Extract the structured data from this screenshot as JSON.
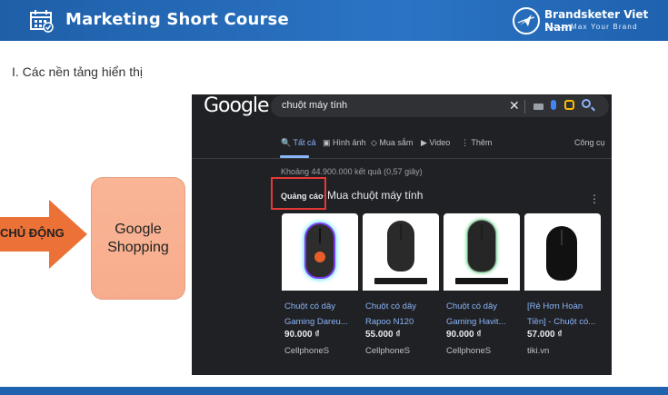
{
  "header": {
    "title": "Marketing Short Course",
    "brand_name": "Brandsketer Viet Nam",
    "brand_tagline": "Max Your Brand",
    "color": "#1f62ae"
  },
  "section_heading": "I.  Các nền tảng hiển thị",
  "diagram": {
    "arrow_label": "CHỦ ĐỘNG",
    "arrow_color": "#ec7136",
    "box_line1": "Google",
    "box_line2": "Shopping",
    "box_color": "#f7ad8d"
  },
  "google": {
    "logo": "Google",
    "search_query": "chuột máy tính",
    "clear": "✕",
    "tabs": [
      {
        "label": "Tất cả"
      },
      {
        "label": "Hình ảnh"
      },
      {
        "label": "Mua sắm"
      },
      {
        "label": "Video"
      },
      {
        "label": "Thêm"
      }
    ],
    "tools": "Công cụ",
    "result_count": "Khoảng 44.900.000 kết quả (0,57 giây)",
    "ads_label": "Quảng cáo",
    "ads_dot": "·",
    "ads_title": "Mua chuột máy tính",
    "ads_menu": "⋮",
    "products": [
      {
        "name": "Chuột có dây Gaming Dareu...",
        "line1": "Chuột có dây",
        "line2": "Gaming Dareu...",
        "price": "90.000 ₫",
        "store": "CellphoneS"
      },
      {
        "name": "Chuột có dây Rapoo N120",
        "line1": "Chuột có dây",
        "line2": "Rapoo N120",
        "price": "55.000 ₫",
        "store": "CellphoneS"
      },
      {
        "name": "Chuột có dây Gaming Havit...",
        "line1": "Chuột có dây",
        "line2": "Gaming Havit...",
        "price": "90.000 ₫",
        "store": "CellphoneS"
      },
      {
        "name": "[Rẻ Hơn Hoàn Tiền] - Chuột có...",
        "line1": "[Rẻ Hơn Hoàn",
        "line2": "Tiền] - Chuột có...",
        "price": "57.000 ₫",
        "store": "tiki.vn"
      }
    ],
    "colors": {
      "background": "#202124",
      "link": "#8ab4f8",
      "highlight_box": "#e53935"
    }
  }
}
